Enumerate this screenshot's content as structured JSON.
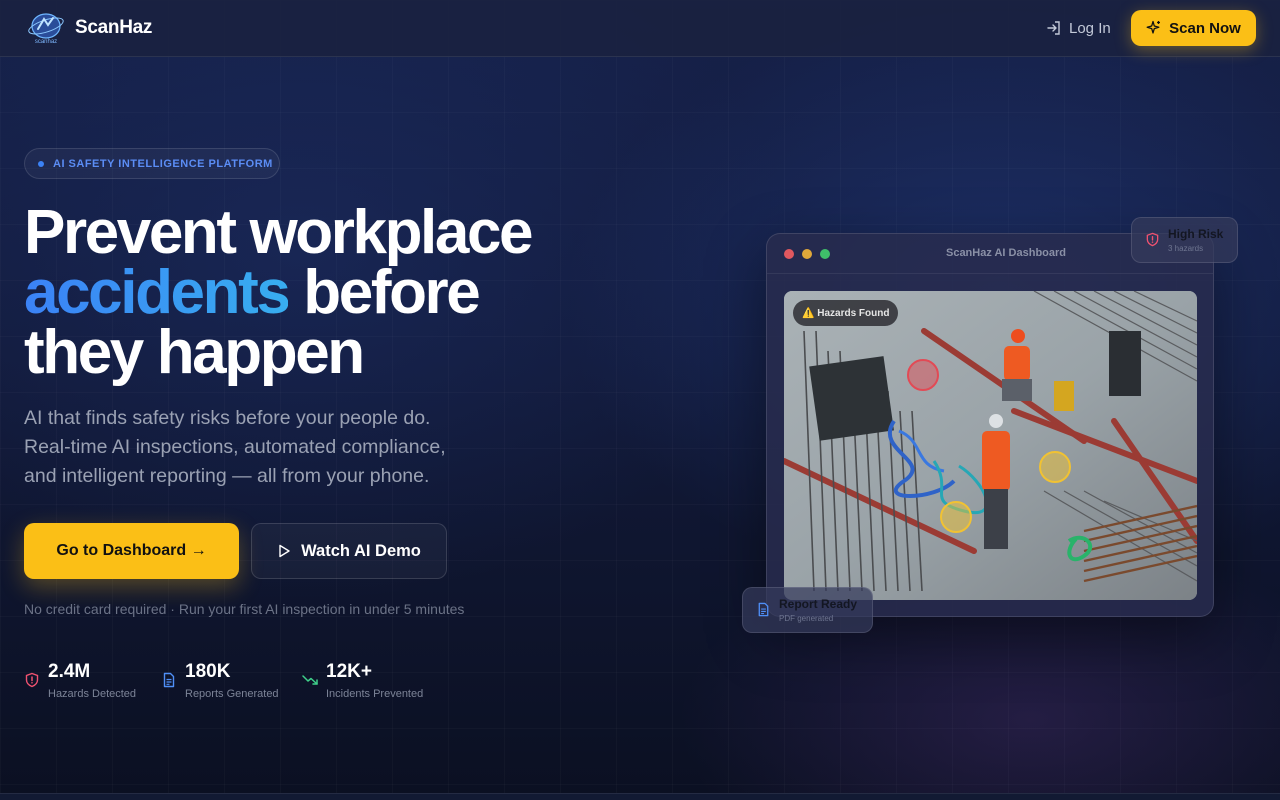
{
  "nav": {
    "brand": "ScanHaz",
    "logo_text": "scanhaz",
    "login_label": "Log In",
    "scan_label": "Scan Now"
  },
  "hero": {
    "badge": "AI SAFETY INTELLIGENCE PLATFORM",
    "headline_line1": "Prevent workplace",
    "headline_accent": "accidents",
    "headline_line2_rest": " before",
    "headline_line3": "they happen",
    "subtitle_line1": "AI that finds safety risks before your people do.",
    "subtitle_line2": "Real-time AI inspections, automated compliance,",
    "subtitle_line3": "and intelligent reporting — all from your phone.",
    "cta_primary": "Go to Dashboard →",
    "cta_secondary": "Watch AI Demo",
    "note": "No credit card required · Run your first AI inspection in under 5 minutes"
  },
  "stats": [
    {
      "value": "2.4M",
      "label": "Hazards Detected",
      "icon": "shield-alert-icon",
      "color": "#f05270"
    },
    {
      "value": "180K",
      "label": "Reports Generated",
      "icon": "document-icon",
      "color": "#4f8ff7"
    },
    {
      "value": "12K+",
      "label": "Incidents Prevented",
      "icon": "trending-down-icon",
      "color": "#3fd08a"
    }
  ],
  "dashboard": {
    "title": "ScanHaz AI Dashboard",
    "hazard_tag": "⚠️ Hazards Found",
    "high_risk_title": "High Risk",
    "high_risk_sub": "3 hazards",
    "report_title": "Report Ready",
    "report_sub": "PDF generated"
  },
  "colors": {
    "accent_yellow": "#fbbf16",
    "accent_blue": "#3b82f6",
    "risk_red": "#f05270"
  }
}
